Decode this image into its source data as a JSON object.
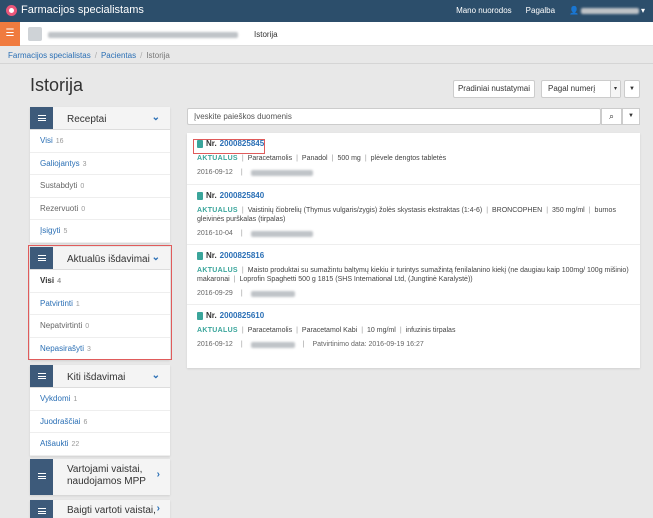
{
  "topbar": {
    "app_title": "Farmacijos specialistams",
    "links": [
      "Mano nuorodos",
      "Pagalba"
    ],
    "user_caret": "▾"
  },
  "subbar": {
    "menu_icon": "hamburger-icon",
    "subtitle": "Istorija"
  },
  "breadcrumb": [
    "Farmacijos specialistas",
    "Pacientas",
    "Istorija"
  ],
  "page": {
    "title": "Istorija",
    "reset_button": "Pradiniai nustatymai",
    "sort_value": "Pagal numerį",
    "search_placeholder": "Įveskite paieškos duomenis"
  },
  "panels": [
    {
      "title": "Receptai",
      "items": [
        {
          "label": "Visi",
          "count": "16"
        },
        {
          "label": "Galiojantys",
          "count": "3"
        },
        {
          "label": "Sustabdyti",
          "count": "0"
        },
        {
          "label": "Rezervuoti",
          "count": "0"
        },
        {
          "label": "Įsigyti",
          "count": "5"
        }
      ]
    },
    {
      "title": "Aktualūs išdavimai",
      "items": [
        {
          "label": "Visi",
          "count": "4"
        },
        {
          "label": "Patvirtinti",
          "count": "1"
        },
        {
          "label": "Nepatvirtinti",
          "count": "0"
        },
        {
          "label": "Nepasirašyti",
          "count": "3"
        }
      ]
    },
    {
      "title": "Kiti išdavimai",
      "items": [
        {
          "label": "Vykdomi",
          "count": "1"
        },
        {
          "label": "Juodraščiai",
          "count": "6"
        },
        {
          "label": "Atšaukti",
          "count": "22"
        }
      ]
    },
    {
      "title": "Vartojami vaistai, naudojamos MPP"
    },
    {
      "title": "Baigti vartoti vaistai,"
    }
  ],
  "prescriptions": [
    {
      "number_label": "Nr.",
      "number": "2000825845",
      "status": "AKTUALUS",
      "details": [
        "Paracetamolis",
        "Panadol",
        "500 mg",
        "plėvele dengtos tabletės"
      ],
      "date": "2016-09-12"
    },
    {
      "number_label": "Nr.",
      "number": "2000825840",
      "status": "AKTUALUS",
      "details": [
        "Vaistinių čiobrelių (Thymus vulgaris/zygis) žolės skystasis ekstraktas (1:4-6)",
        "BRONCOPHEN",
        "350 mg/ml",
        "burnos gleivinės purškalas (tirpalas)"
      ],
      "date": "2016-10-04"
    },
    {
      "number_label": "Nr.",
      "number": "2000825816",
      "status": "AKTUALUS",
      "details": [
        "Maisto produktai su sumažintu baltymų kiekiu ir turintys sumažintą fenilalanino kiekį (ne daugiau kaip 100mg/ 100g mišinio) makaronai",
        "Loprofin Spaghetti 500 g 1815 (SHS International Ltd, (Jungtinė Karalystė))"
      ],
      "date": "2016-09-29"
    },
    {
      "number_label": "Nr.",
      "number": "2000825610",
      "status": "AKTUALUS",
      "details": [
        "Paracetamolis",
        "Paracetamol Kabi",
        "10 mg/ml",
        "infuzinis tirpalas"
      ],
      "date": "2016-09-12",
      "confirmation": "Patvirtinimo data: 2016-09-19 16:27"
    }
  ],
  "colors": {
    "topbar": "#2c4e6b",
    "accent": "#f07b3f",
    "link": "#2a6fb5",
    "status": "#3aa59b",
    "highlight": "#e05b5b"
  }
}
